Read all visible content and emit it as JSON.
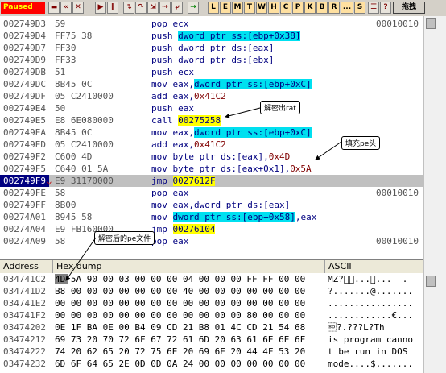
{
  "toolbar": {
    "status": "Paused",
    "icons": [
      "open-icon",
      "restart-icon",
      "close-icon",
      "run-icon",
      "pause-icon",
      "step-into-icon",
      "step-over-icon",
      "trace-into-icon",
      "trace-over-icon",
      "execute-till-return-icon",
      "go-to-icon"
    ],
    "letters": [
      "L",
      "E",
      "M",
      "T",
      "W",
      "H",
      "C",
      "P",
      "K",
      "B",
      "R",
      "...",
      "S"
    ],
    "chinese_button": "拖拽"
  },
  "disasm": {
    "rows": [
      {
        "addr": "002749D3",
        "hex": "59",
        "asm": "pop ecx",
        "comment": "00010010"
      },
      {
        "addr": "002749D4",
        "hex": "FF75 38",
        "asm_pre": "push ",
        "asm_hl": "dword ptr ss:[ebp+0x38]",
        "asm_post": ""
      },
      {
        "addr": "002749D7",
        "hex": "FF30",
        "asm": "push dword ptr ds:[eax]"
      },
      {
        "addr": "002749D9",
        "hex": "FF33",
        "asm": "push dword ptr ds:[ebx]"
      },
      {
        "addr": "002749DB",
        "hex": "51",
        "asm": "push ecx"
      },
      {
        "addr": "002749DC",
        "hex": "8B45 0C",
        "asm_pre": "mov eax,",
        "asm_hl": "dword ptr ss:[ebp+0xC]",
        "asm_post": ""
      },
      {
        "addr": "002749DF",
        "hex": "05 C2410000",
        "asm_pre": "add eax,",
        "asm_num": "0x41C2"
      },
      {
        "addr": "002749E4",
        "hex": "50",
        "asm": "push eax"
      },
      {
        "addr": "002749E5",
        "hex": "E8 6E080000",
        "asm_call": "call ",
        "asm_target": "00275258"
      },
      {
        "addr": "002749EA",
        "hex": "8B45 0C",
        "asm_pre": "mov eax,",
        "asm_hl": "dword ptr ss:[ebp+0xC]",
        "asm_post": ""
      },
      {
        "addr": "002749ED",
        "hex": "05 C2410000",
        "asm_pre": "add eax,",
        "asm_num": "0x41C2"
      },
      {
        "addr": "002749F2",
        "hex": "C600 4D",
        "asm_pre": "mov byte ptr ds:[eax],",
        "asm_num": "0x4D"
      },
      {
        "addr": "002749F5",
        "hex": "C640 01 5A",
        "asm_pre": "mov byte ptr ds:[eax+0x1],",
        "asm_num": "0x5A"
      },
      {
        "addr": "002749F9",
        "hex": "E9 31170000",
        "asm_call": "jmp ",
        "asm_target": "0027612F",
        "eip": true
      },
      {
        "addr": "002749FE",
        "hex": "58",
        "asm": "pop eax",
        "comment": "00010010"
      },
      {
        "addr": "002749FF",
        "hex": "8B00",
        "asm": "mov eax,dword ptr ds:[eax]"
      },
      {
        "addr": "00274A01",
        "hex": "8945 58",
        "asm_pre": "mov ",
        "asm_hl": "dword ptr ss:[ebp+0x58]",
        "asm_post": ",eax"
      },
      {
        "addr": "00274A04",
        "hex": "E9 FB160000",
        "asm_call": "jmp ",
        "asm_target": "00276104"
      },
      {
        "addr": "00274A09",
        "hex": "58",
        "asm": "pop eax",
        "comment": "00010010"
      }
    ]
  },
  "annotations": {
    "decrypt_rat": "解密出rat",
    "fill_pe_header": "填充pe头",
    "decrypted_pe_file": "解密后的pe文件"
  },
  "dump": {
    "headers": {
      "address": "Address",
      "hex": "Hex dump",
      "ascii": "ASCII"
    },
    "rows": [
      {
        "addr": "034741C2",
        "hex": "4D 5A 90 00 03 00 00 00 04 00 00 00 FF FF 00 00",
        "ascii": "MZ?\u0000\u0003...\u0004...  ."
      },
      {
        "addr": "034741D2",
        "hex": "B8 00 00 00 00 00 00 00 40 00 00 00 00 00 00 00",
        "ascii": "?.......@......."
      },
      {
        "addr": "034741E2",
        "hex": "00 00 00 00 00 00 00 00 00 00 00 00 00 00 00 00",
        "ascii": "................"
      },
      {
        "addr": "034741F2",
        "hex": "00 00 00 00 00 00 00 00 00 00 00 00 80 00 00 00",
        "ascii": "............€..."
      },
      {
        "addr": "03474202",
        "hex": "0E 1F BA 0E 00 B4 09 CD 21 B8 01 4C CD 21 54 68",
        "ascii": "\u000e?.???L?Th"
      },
      {
        "addr": "03474212",
        "hex": "69 73 20 70 72 6F 67 72 61 6D 20 63 61 6E 6E 6F",
        "ascii": "is program canno"
      },
      {
        "addr": "03474222",
        "hex": "74 20 62 65 20 72 75 6E 20 69 6E 20 44 4F 53 20",
        "ascii": "t be run in DOS "
      },
      {
        "addr": "03474232",
        "hex": "6D 6F 64 65 2E 0D 0D 0A 24 00 00 00 00 00 00 00",
        "ascii": "mode....$......."
      }
    ]
  }
}
